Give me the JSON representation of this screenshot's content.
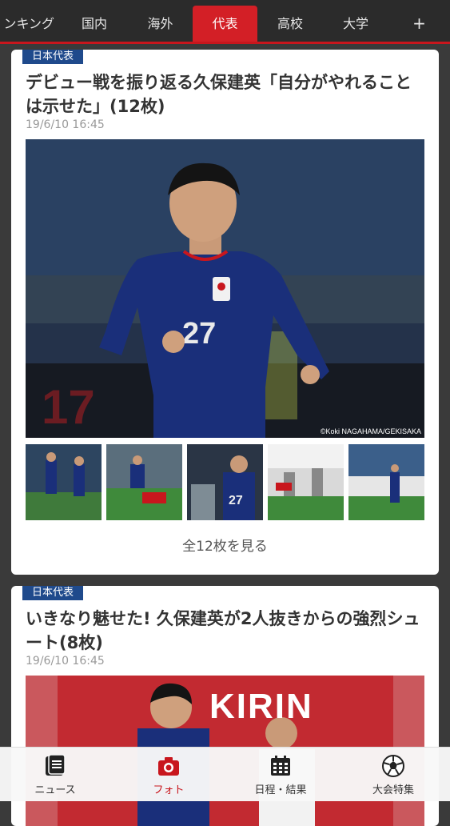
{
  "top_nav": {
    "tabs": [
      {
        "label": "ンキング"
      },
      {
        "label": "国内"
      },
      {
        "label": "海外"
      },
      {
        "label": "代表",
        "active": true
      },
      {
        "label": "高校"
      },
      {
        "label": "大学"
      },
      {
        "label": "+"
      }
    ]
  },
  "articles": [
    {
      "category": "日本代表",
      "title": "デビュー戦を振り返る久保建英「自分がやれることは示せた」(12枚)",
      "date": "19/6/10 16:45",
      "photo_credit": "©Koki NAGAHAMA/GEKISAKA",
      "see_all": "全12枚を見る"
    },
    {
      "category": "日本代表",
      "title": "いきなり魅せた! 久保建英が2人抜きからの強烈シュート(8枚)",
      "date": "19/6/10 16:45",
      "banner_text": "KIRIN"
    }
  ],
  "bottom_nav": {
    "items": [
      {
        "label": "ニュース",
        "icon": "news-icon"
      },
      {
        "label": "フォト",
        "icon": "camera-icon",
        "active": true
      },
      {
        "label": "日程・結果",
        "icon": "calendar-icon"
      },
      {
        "label": "大会特集",
        "icon": "soccer-ball-icon"
      }
    ]
  },
  "colors": {
    "accent": "#c8161d",
    "badge": "#1f4a8c",
    "jersey": "#1a2f7a"
  }
}
